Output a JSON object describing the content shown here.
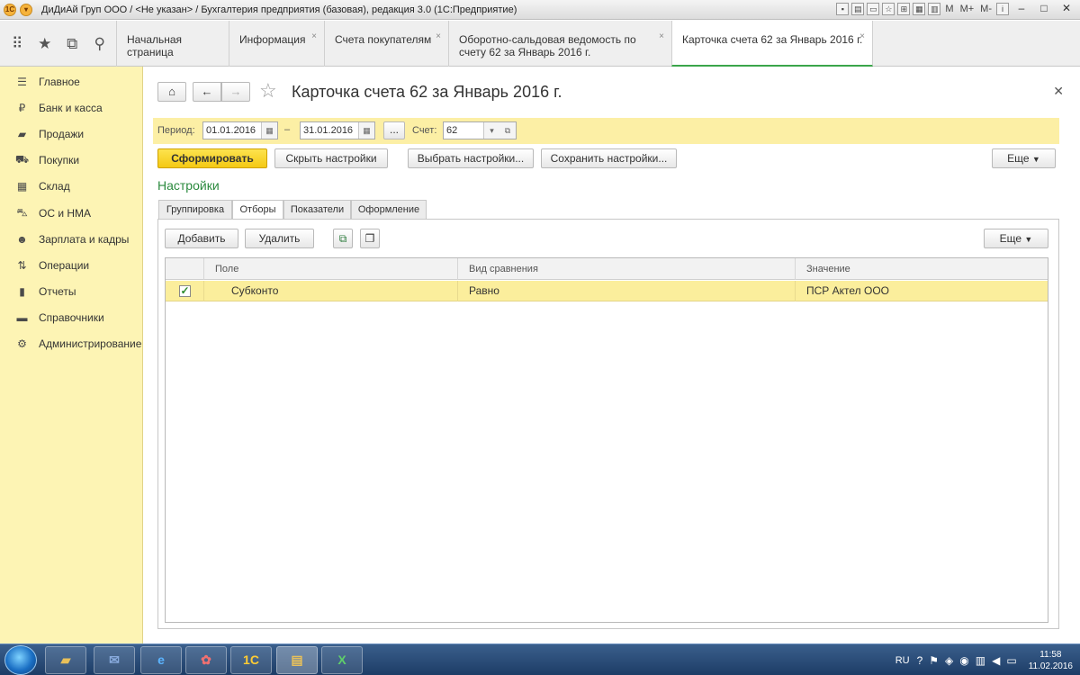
{
  "window": {
    "title": "ДиДиАй Груп ООО / <Не указан> / Бухгалтерия предприятия (базовая), редакция 3.0  (1С:Предприятие)",
    "tray_labels": [
      "M",
      "M+",
      "M-"
    ]
  },
  "tabs": [
    {
      "label": "Начальная страница",
      "closable": false
    },
    {
      "label": "Информация",
      "closable": true
    },
    {
      "label": "Счета покупателям",
      "closable": true
    },
    {
      "label": "Оборотно-сальдовая ведомость по счету 62 за Январь 2016 г.",
      "closable": true
    },
    {
      "label": "Карточка счета 62 за Январь 2016 г.",
      "closable": true,
      "active": true
    }
  ],
  "sidebar": {
    "items": [
      {
        "label": "Главное",
        "icon": "menu-icon"
      },
      {
        "label": "Банк и касса",
        "icon": "ruble-icon"
      },
      {
        "label": "Продажи",
        "icon": "bag-icon"
      },
      {
        "label": "Покупки",
        "icon": "cart-icon"
      },
      {
        "label": "Склад",
        "icon": "warehouse-icon"
      },
      {
        "label": "ОС и НМА",
        "icon": "car-icon"
      },
      {
        "label": "Зарплата и кадры",
        "icon": "person-icon"
      },
      {
        "label": "Операции",
        "icon": "operations-icon"
      },
      {
        "label": "Отчеты",
        "icon": "chart-icon"
      },
      {
        "label": "Справочники",
        "icon": "book-icon"
      },
      {
        "label": "Администрирование",
        "icon": "gear-icon"
      }
    ]
  },
  "form": {
    "title": "Карточка счета 62 за Январь 2016 г.",
    "period_label": "Период:",
    "date_from": "01.01.2016",
    "date_sep": "–",
    "date_to": "31.01.2016",
    "dots_label": "...",
    "account_label": "Счет:",
    "account_value": "62",
    "buttons": {
      "generate": "Сформировать",
      "hide_settings": "Скрыть настройки",
      "choose_settings": "Выбрать настройки...",
      "save_settings": "Сохранить настройки...",
      "more": "Еще"
    },
    "settings_title": "Настройки",
    "settings_tabs": [
      {
        "label": "Группировка"
      },
      {
        "label": "Отборы",
        "active": true
      },
      {
        "label": "Показатели"
      },
      {
        "label": "Оформление"
      }
    ],
    "filter_buttons": {
      "add": "Добавить",
      "delete": "Удалить",
      "more": "Еще"
    },
    "grid": {
      "columns": [
        "Поле",
        "Вид сравнения",
        "Значение"
      ],
      "rows": [
        {
          "checked": true,
          "field": "Субконто",
          "comparison": "Равно",
          "value": "ПСР Актел ООО"
        }
      ]
    }
  },
  "taskbar": {
    "lang": "RU",
    "time": "11:58",
    "date": "11.02.2016"
  }
}
